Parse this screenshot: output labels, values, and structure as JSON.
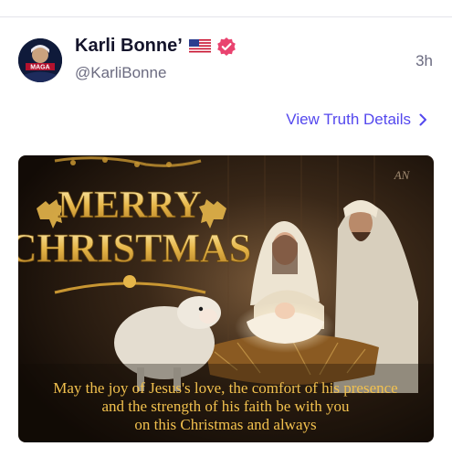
{
  "post": {
    "author_name": "Karli Bonne’",
    "author_handle": "@KarliBonne",
    "timestamp": "3h",
    "details_link": "View Truth Details",
    "avatar_text": "MAGA"
  },
  "media": {
    "greeting_line1": "MERRY",
    "greeting_line2": "CHRISTMAS",
    "watermark": "AN",
    "message_line1": "May the joy of Jesus's love, the comfort of his presence",
    "message_line2": "and the strength of his faith be with you",
    "message_line3": "on this Christmas and always"
  },
  "colors": {
    "accent": "#5448ee",
    "verified_badge": "#e9436f",
    "name_text": "#14142b",
    "secondary_text": "#6b6b80",
    "gold_text": "#f2c14e"
  }
}
